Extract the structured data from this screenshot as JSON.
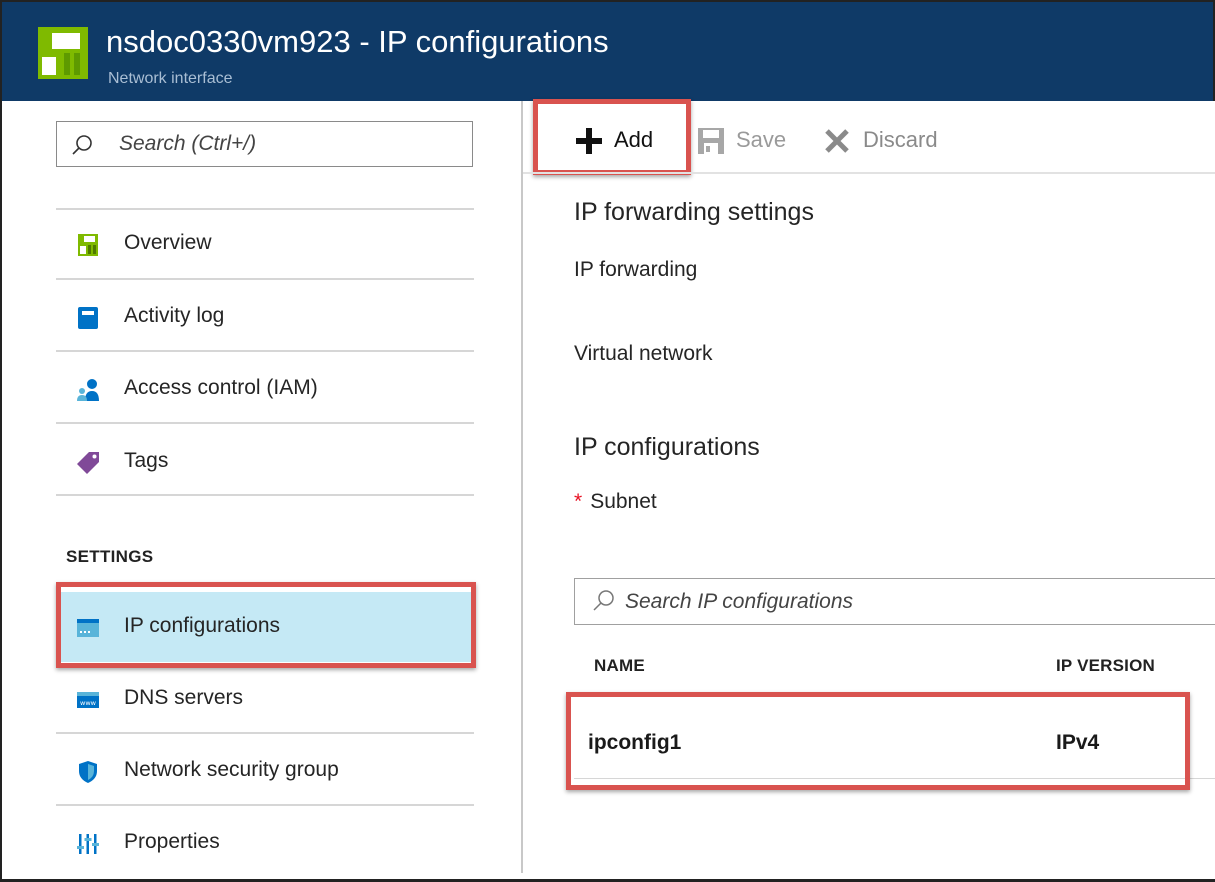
{
  "header": {
    "title": "nsdoc0330vm923 - IP configurations",
    "subtitle": "Network interface",
    "logo_icon": "network-interface-icon"
  },
  "sidebar": {
    "search_placeholder": "Search (Ctrl+/)",
    "items": [
      {
        "label": "Overview",
        "icon": "overview-icon"
      },
      {
        "label": "Activity log",
        "icon": "activity-log-icon"
      },
      {
        "label": "Access control (IAM)",
        "icon": "iam-icon"
      },
      {
        "label": "Tags",
        "icon": "tag-icon"
      }
    ],
    "section_title": "SETTINGS",
    "settings_items": [
      {
        "label": "IP configurations",
        "icon": "ip-config-icon",
        "selected": true
      },
      {
        "label": "DNS servers",
        "icon": "dns-icon"
      },
      {
        "label": "Network security group",
        "icon": "shield-icon"
      },
      {
        "label": "Properties",
        "icon": "properties-icon"
      }
    ]
  },
  "toolbar": {
    "add_label": "Add",
    "save_label": "Save",
    "discard_label": "Discard"
  },
  "main": {
    "forwarding_heading": "IP forwarding settings",
    "ip_forwarding_label": "IP forwarding",
    "virtual_network_label": "Virtual network",
    "ip_config_heading": "IP configurations",
    "subnet_required_mark": "*",
    "subnet_label": "Subnet",
    "search_placeholder": "Search IP configurations",
    "table": {
      "columns": [
        "NAME",
        "IP VERSION"
      ],
      "rows": [
        {
          "name": "ipconfig1",
          "ip_version": "IPv4"
        }
      ]
    }
  },
  "colors": {
    "header_bg": "#0f3a67",
    "selected_bg": "#c5e9f5",
    "highlight_border": "#d9534f",
    "azure_green": "#7fba00",
    "azure_blue": "#0072c6"
  }
}
